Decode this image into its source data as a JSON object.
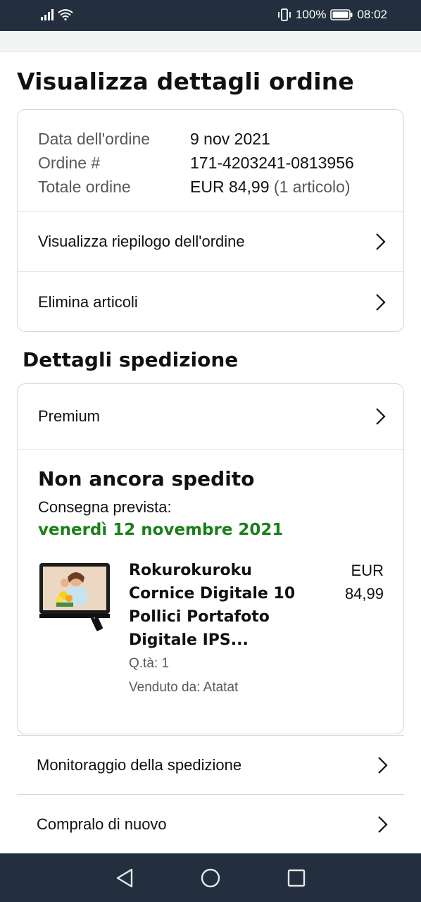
{
  "status_bar": {
    "battery": "100%",
    "time": "08:02"
  },
  "page": {
    "title": "Visualizza dettagli ordine"
  },
  "order": {
    "date_label": "Data dell'ordine",
    "date_value": "9 nov 2021",
    "number_label": "Ordine #",
    "number_value": "171-4203241-0813956",
    "total_label": "Totale ordine",
    "total_value": "EUR 84,99",
    "total_items": "(1 articolo)"
  },
  "order_actions": {
    "summary": "Visualizza riepilogo dell'ordine",
    "remove_items": "Elimina articoli"
  },
  "shipping": {
    "section_title": "Dettagli spedizione",
    "service": "Premium",
    "status": "Non ancora spedito",
    "delivery_label": "Consegna prevista:",
    "delivery_date": "venerdì 12 novembre 2021"
  },
  "item": {
    "title_lines": [
      "Rokurokuroku",
      "Cornice Digitale 10",
      "Pollici Portafoto",
      "Digitale IPS..."
    ],
    "price_currency": "EUR",
    "price_value": "84,99",
    "quantity": "Q.tà: 1",
    "seller": "Venduto da: Atatat"
  },
  "bottom_actions": {
    "track": "Monitoraggio della spedizione",
    "buy_again": "Compralo di nuovo"
  },
  "icons": {
    "chevron": "chevron-right-icon",
    "back": "back-triangle-icon",
    "home": "home-circle-icon",
    "recents": "recents-square-icon"
  },
  "colors": {
    "bar": "#232f3e",
    "delivery_green": "#1a7f1a",
    "muted": "#565959"
  }
}
